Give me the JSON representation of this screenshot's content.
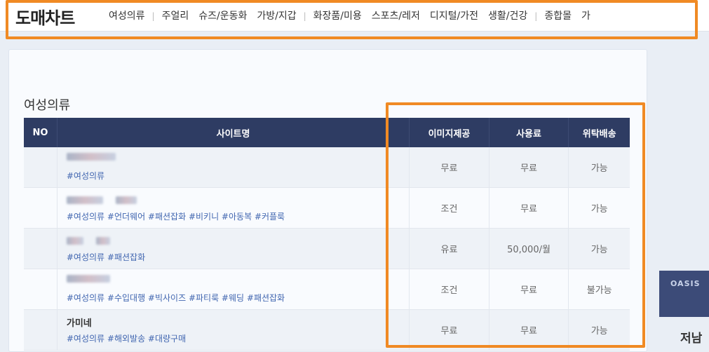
{
  "header": {
    "logo": "도매차트",
    "nav": [
      {
        "label": "여성의류"
      },
      {
        "sep": "|"
      },
      {
        "label": "주얼리"
      },
      {
        "label": "슈즈/운동화"
      },
      {
        "label": "가방/지갑"
      },
      {
        "sep": "|"
      },
      {
        "label": "화장품/미용"
      },
      {
        "label": "스포츠/레저"
      },
      {
        "label": "디지털/가전"
      },
      {
        "label": "생활/건강"
      },
      {
        "sep": "|"
      },
      {
        "label": "종합몰"
      },
      {
        "label": "가"
      }
    ]
  },
  "section": {
    "title": "여성의류"
  },
  "table": {
    "headers": {
      "no": "NO",
      "site": "사이트명",
      "image": "이미지제공",
      "fee": "사용료",
      "delivery": "위탁배송"
    },
    "rows": [
      {
        "tags": "#여성의류",
        "image": "무료",
        "fee": "무료",
        "delivery": "가능"
      },
      {
        "tags": "#여성의류 #언더웨어 #패션잡화 #비키니 #아동복 #커플룩",
        "image": "조건",
        "fee": "무료",
        "delivery": "가능"
      },
      {
        "tags": "#여성의류 #패션잡화",
        "image": "유료",
        "fee": "50,000/월",
        "delivery": "가능"
      },
      {
        "tags": "#여성의류 #수입대행 #빅사이즈 #파티룩 #웨딩 #패션잡화",
        "image": "조건",
        "fee": "무료",
        "delivery": "불가능"
      },
      {
        "name": "가미네",
        "tags": "#여성의류 #해외발송 #대량구매",
        "image": "무료",
        "fee": "무료",
        "delivery": "가능"
      }
    ]
  },
  "ad": {
    "label": "OASIS",
    "text": "저남"
  },
  "colors": {
    "highlight": "#f08a24",
    "header_bg": "#2e3c63",
    "tag": "#4166b0"
  }
}
